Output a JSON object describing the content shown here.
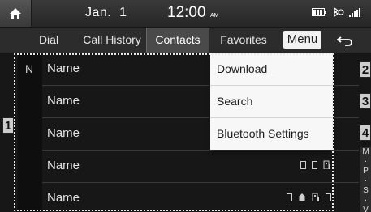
{
  "statusbar": {
    "date": "Jan.  1",
    "time": "12:00",
    "ampm": "AM"
  },
  "tabs": [
    {
      "label": "Dial",
      "active": false
    },
    {
      "label": "Call History",
      "active": false
    },
    {
      "label": "Contacts",
      "active": true
    },
    {
      "label": "Favorites",
      "active": false
    }
  ],
  "menu_label": "Menu",
  "index_letter": "N",
  "contacts": [
    {
      "name": "Name"
    },
    {
      "name": "Name"
    },
    {
      "name": "Name"
    },
    {
      "name": "Name"
    },
    {
      "name": "Name"
    }
  ],
  "dropdown": [
    "Download",
    "Search",
    "Bluetooth Settings"
  ],
  "scroll_index": [
    "M",
    "·",
    "P",
    "·",
    "S",
    "·",
    "V"
  ],
  "callouts": [
    "1",
    "2",
    "3",
    "4"
  ],
  "colors": {
    "background": "#171717",
    "menu": "#f7f7f7",
    "active_tab": "#4a4a4a"
  }
}
